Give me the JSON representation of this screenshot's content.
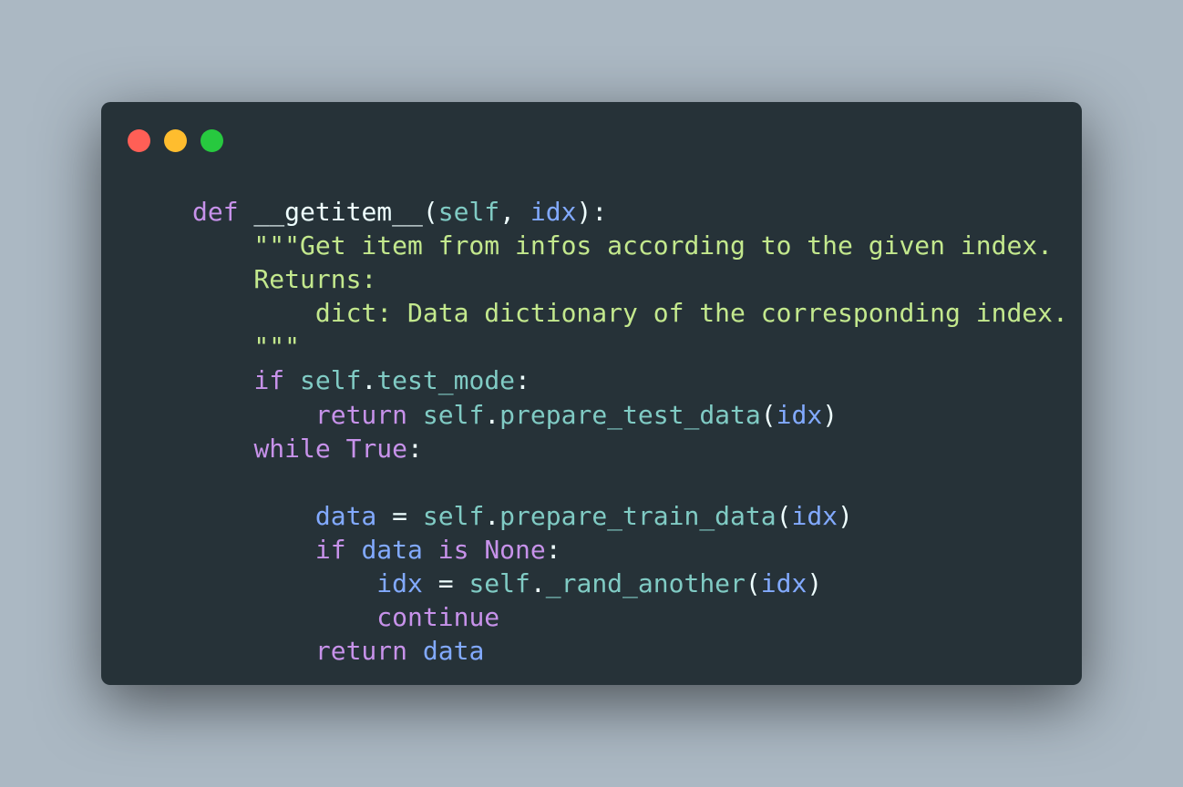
{
  "window": {
    "controls": {
      "close_color": "#ff5f56",
      "minimize_color": "#ffbd2e",
      "maximize_color": "#27c93f"
    }
  },
  "theme": {
    "keyword": "#c792ea",
    "function": "#eeffff",
    "self": "#80cbc4",
    "variable": "#82aaff",
    "string": "#c3e88d",
    "punctuation": "#eeffff",
    "method": "#80cbc4"
  },
  "code": {
    "lines": [
      [
        {
          "t": "def",
          "c": "keyword"
        },
        {
          "t": " __getitem__",
          "c": "function"
        },
        {
          "t": "(",
          "c": "punctuation"
        },
        {
          "t": "self",
          "c": "self"
        },
        {
          "t": ", ",
          "c": "punctuation"
        },
        {
          "t": "idx",
          "c": "variable"
        },
        {
          "t": "):",
          "c": "punctuation"
        }
      ],
      [
        {
          "t": "    \"\"\"Get item from infos according to the given index.",
          "c": "string"
        }
      ],
      [
        {
          "t": "    Returns:",
          "c": "string"
        }
      ],
      [
        {
          "t": "        dict: Data dictionary of the corresponding index.",
          "c": "string"
        }
      ],
      [
        {
          "t": "    \"\"\"",
          "c": "string"
        }
      ],
      [
        {
          "t": "    ",
          "c": "punctuation"
        },
        {
          "t": "if",
          "c": "keyword"
        },
        {
          "t": " ",
          "c": "punctuation"
        },
        {
          "t": "self",
          "c": "self"
        },
        {
          "t": ".",
          "c": "punctuation"
        },
        {
          "t": "test_mode",
          "c": "method"
        },
        {
          "t": ":",
          "c": "punctuation"
        }
      ],
      [
        {
          "t": "        ",
          "c": "punctuation"
        },
        {
          "t": "return",
          "c": "keyword"
        },
        {
          "t": " ",
          "c": "punctuation"
        },
        {
          "t": "self",
          "c": "self"
        },
        {
          "t": ".",
          "c": "punctuation"
        },
        {
          "t": "prepare_test_data",
          "c": "method"
        },
        {
          "t": "(",
          "c": "punctuation"
        },
        {
          "t": "idx",
          "c": "variable"
        },
        {
          "t": ")",
          "c": "punctuation"
        }
      ],
      [
        {
          "t": "    ",
          "c": "punctuation"
        },
        {
          "t": "while",
          "c": "keyword"
        },
        {
          "t": " ",
          "c": "punctuation"
        },
        {
          "t": "True",
          "c": "keyword"
        },
        {
          "t": ":",
          "c": "punctuation"
        }
      ],
      [],
      [
        {
          "t": "        ",
          "c": "punctuation"
        },
        {
          "t": "data",
          "c": "variable"
        },
        {
          "t": " = ",
          "c": "punctuation"
        },
        {
          "t": "self",
          "c": "self"
        },
        {
          "t": ".",
          "c": "punctuation"
        },
        {
          "t": "prepare_train_data",
          "c": "method"
        },
        {
          "t": "(",
          "c": "punctuation"
        },
        {
          "t": "idx",
          "c": "variable"
        },
        {
          "t": ")",
          "c": "punctuation"
        }
      ],
      [
        {
          "t": "        ",
          "c": "punctuation"
        },
        {
          "t": "if",
          "c": "keyword"
        },
        {
          "t": " ",
          "c": "punctuation"
        },
        {
          "t": "data",
          "c": "variable"
        },
        {
          "t": " ",
          "c": "punctuation"
        },
        {
          "t": "is",
          "c": "keyword"
        },
        {
          "t": " ",
          "c": "punctuation"
        },
        {
          "t": "None",
          "c": "keyword"
        },
        {
          "t": ":",
          "c": "punctuation"
        }
      ],
      [
        {
          "t": "            ",
          "c": "punctuation"
        },
        {
          "t": "idx",
          "c": "variable"
        },
        {
          "t": " = ",
          "c": "punctuation"
        },
        {
          "t": "self",
          "c": "self"
        },
        {
          "t": ".",
          "c": "punctuation"
        },
        {
          "t": "_rand_another",
          "c": "method"
        },
        {
          "t": "(",
          "c": "punctuation"
        },
        {
          "t": "idx",
          "c": "variable"
        },
        {
          "t": ")",
          "c": "punctuation"
        }
      ],
      [
        {
          "t": "            ",
          "c": "punctuation"
        },
        {
          "t": "continue",
          "c": "keyword"
        }
      ],
      [
        {
          "t": "        ",
          "c": "punctuation"
        },
        {
          "t": "return",
          "c": "keyword"
        },
        {
          "t": " ",
          "c": "punctuation"
        },
        {
          "t": "data",
          "c": "variable"
        }
      ]
    ]
  }
}
